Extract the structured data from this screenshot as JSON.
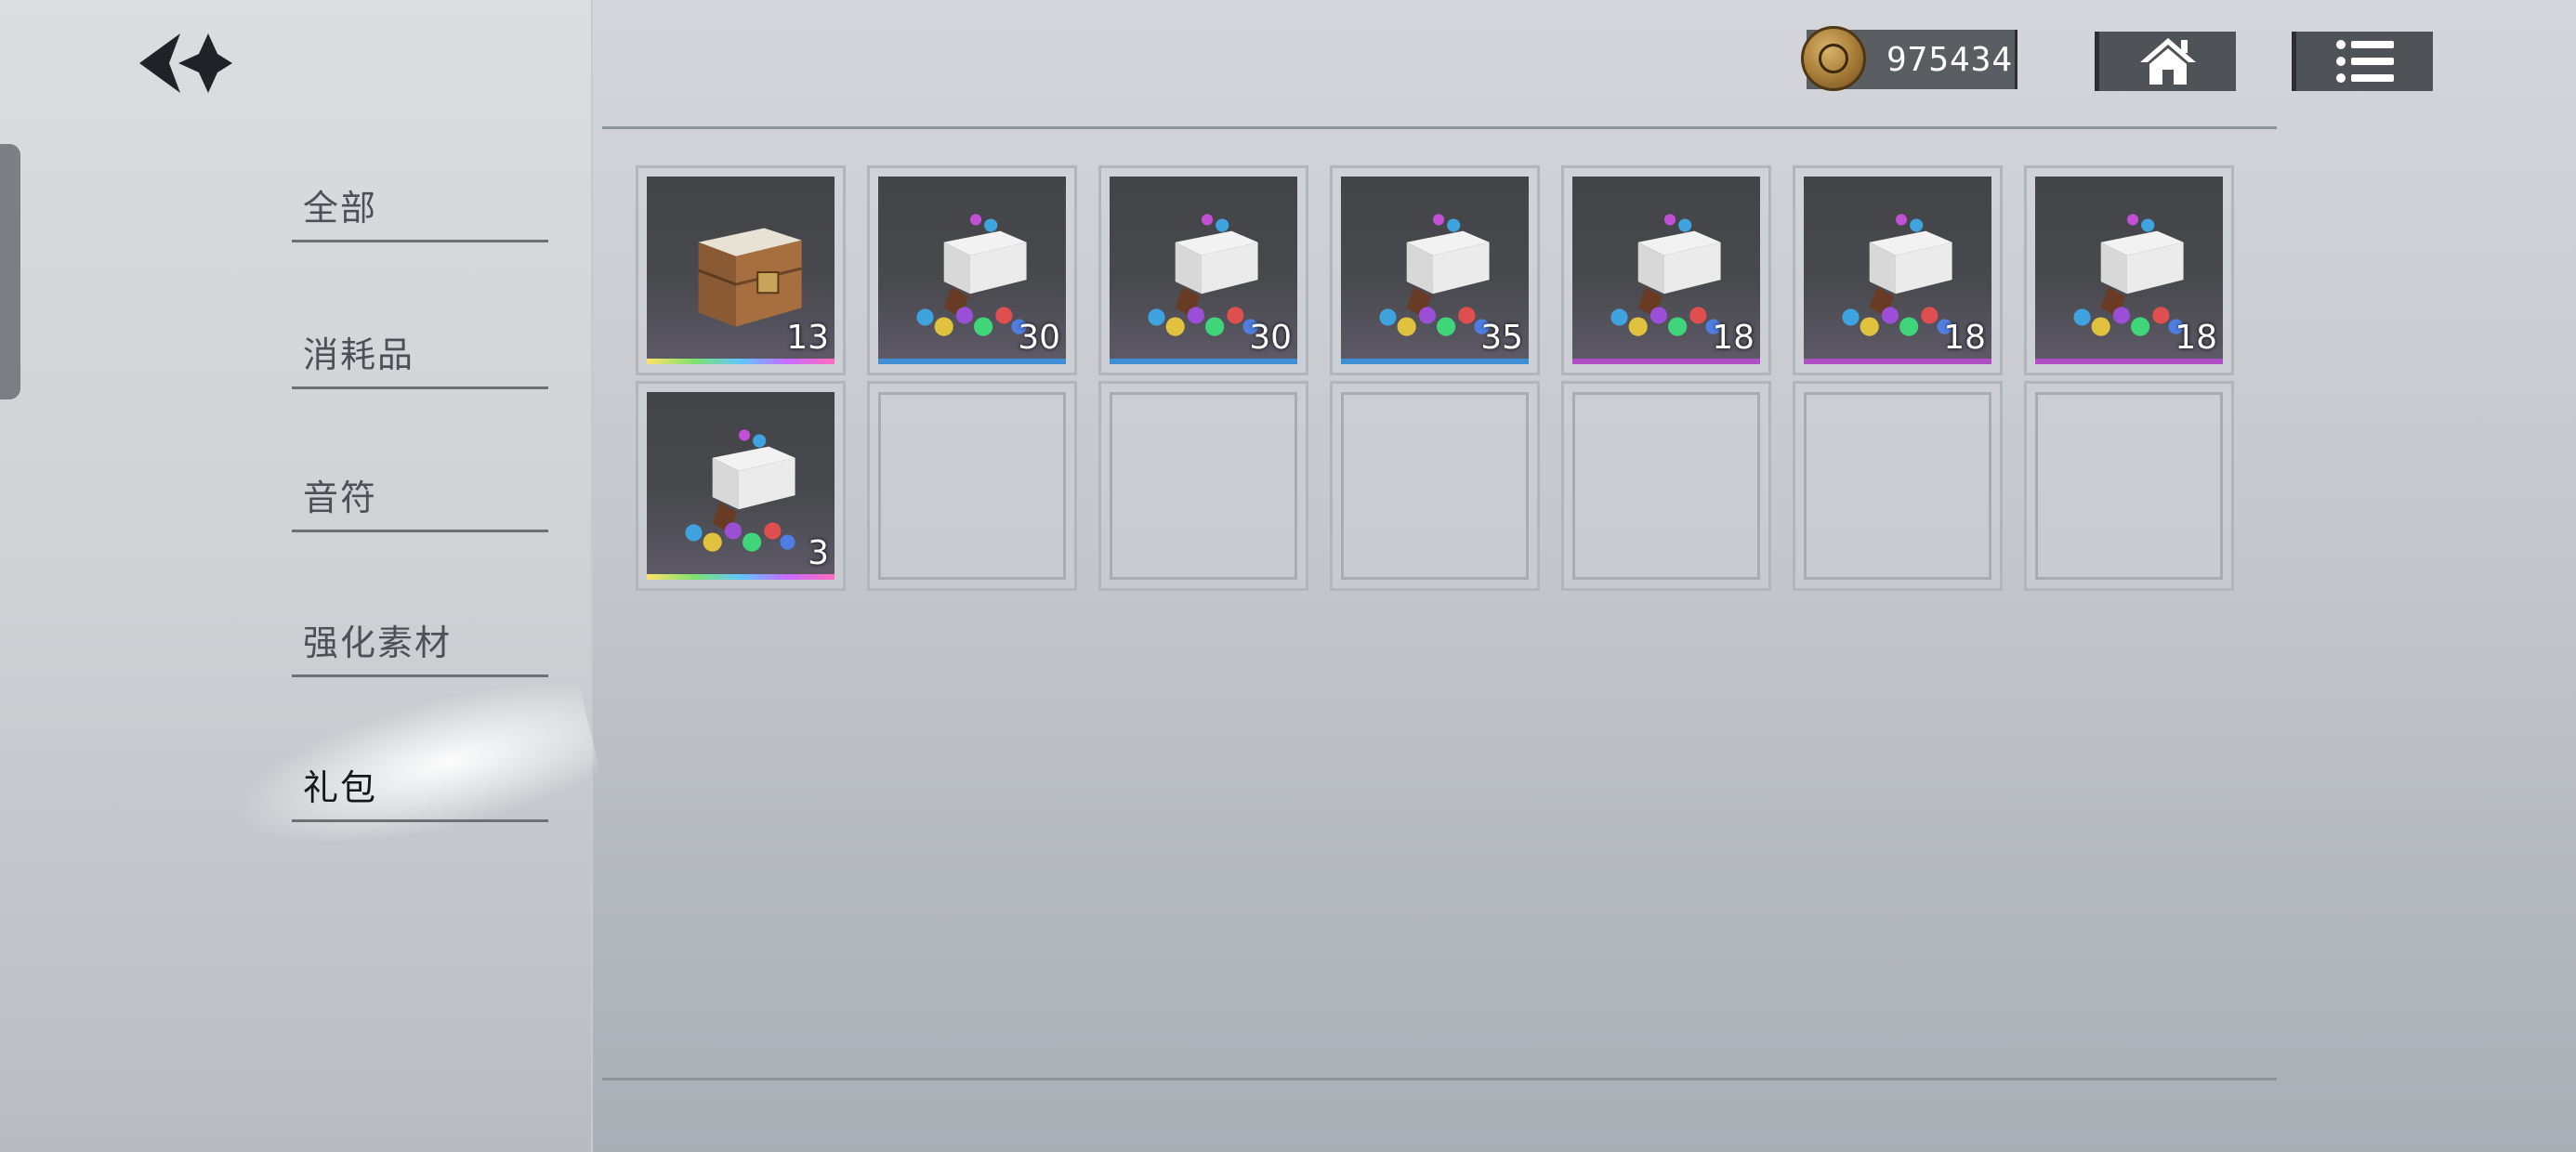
{
  "header": {
    "currency_amount": "975434",
    "currency_icon": "coin-icon",
    "home_icon": "home-icon",
    "menu_icon": "list-menu-icon"
  },
  "sidebar": {
    "back_icon": "back-arrow-icon",
    "categories": [
      {
        "label": "全部",
        "active": false
      },
      {
        "label": "消耗品",
        "active": false
      },
      {
        "label": "音符",
        "active": false
      },
      {
        "label": "强化素材",
        "active": false
      },
      {
        "label": "礼包",
        "active": true
      }
    ]
  },
  "inventory": {
    "items": [
      {
        "count": "13",
        "icon": "wooden-box-icon",
        "rarity_color": "rainbow"
      },
      {
        "count": "30",
        "icon": "crystal-chest-icon",
        "rarity_color": "#3f8fd6"
      },
      {
        "count": "30",
        "icon": "crystal-chest-icon",
        "rarity_color": "#3f8fd6"
      },
      {
        "count": "35",
        "icon": "crystal-chest-icon",
        "rarity_color": "#3f8fd6"
      },
      {
        "count": "18",
        "icon": "crystal-chest-icon",
        "rarity_color": "#b04fc4"
      },
      {
        "count": "18",
        "icon": "crystal-chest-icon",
        "rarity_color": "#b04fc4"
      },
      {
        "count": "18",
        "icon": "crystal-chest-icon",
        "rarity_color": "#b04fc4"
      },
      {
        "count": "3",
        "icon": "crystal-chest-icon",
        "rarity_color": "rainbow"
      }
    ],
    "total_slots": 14
  }
}
